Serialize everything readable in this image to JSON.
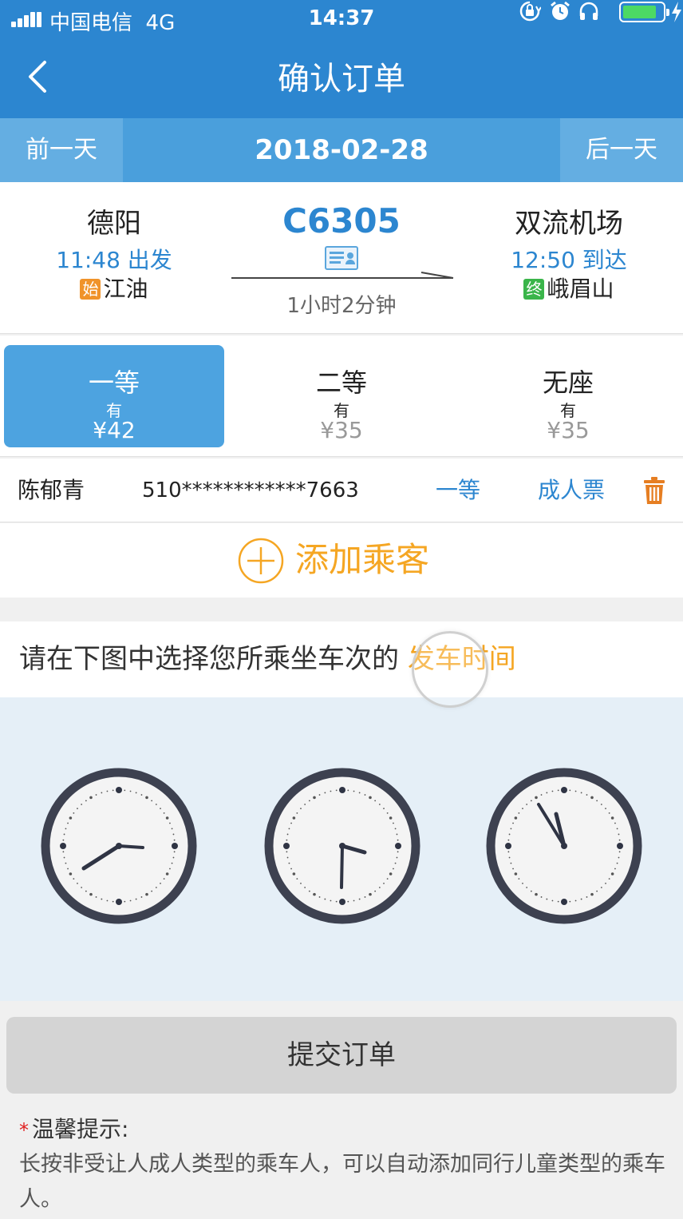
{
  "status_bar": {
    "carrier": "中国电信",
    "network": "4G",
    "time": "14:37"
  },
  "nav": {
    "title": "确认订单"
  },
  "date_bar": {
    "prev_label": "前一天",
    "date": "2018-02-28",
    "next_label": "后一天"
  },
  "train": {
    "number": "C6305",
    "duration": "1小时2分钟",
    "from": {
      "station": "德阳",
      "time": "11:48 出发",
      "terminal_tag": "始",
      "terminal": "江油"
    },
    "to": {
      "station": "双流机场",
      "time": "12:50 到达",
      "terminal_tag": "终",
      "terminal": "峨眉山"
    }
  },
  "seat_classes": [
    {
      "name": "一等",
      "availability": "有",
      "price": "¥42",
      "selected": true
    },
    {
      "name": "二等",
      "availability": "有",
      "price": "¥35",
      "selected": false
    },
    {
      "name": "无座",
      "availability": "有",
      "price": "¥35",
      "selected": false
    }
  ],
  "passenger": {
    "name": "陈郁青",
    "id_number": "510************7663",
    "seat_class": "一等",
    "ticket_type": "成人票"
  },
  "add_passenger_label": "添加乘客",
  "captcha": {
    "prompt": "请在下图中选择您所乘坐车次的",
    "highlight": "发车时间"
  },
  "submit_label": "提交订单",
  "tips": {
    "title": "温馨提示:",
    "body": "长按非受让人成人类型的乘车人，可以自动添加同行儿童类型的乘车人。"
  },
  "colors": {
    "nav_blue": "#2c86d0",
    "accent_orange": "#f5a623",
    "selected_seat": "#4da3e0"
  }
}
